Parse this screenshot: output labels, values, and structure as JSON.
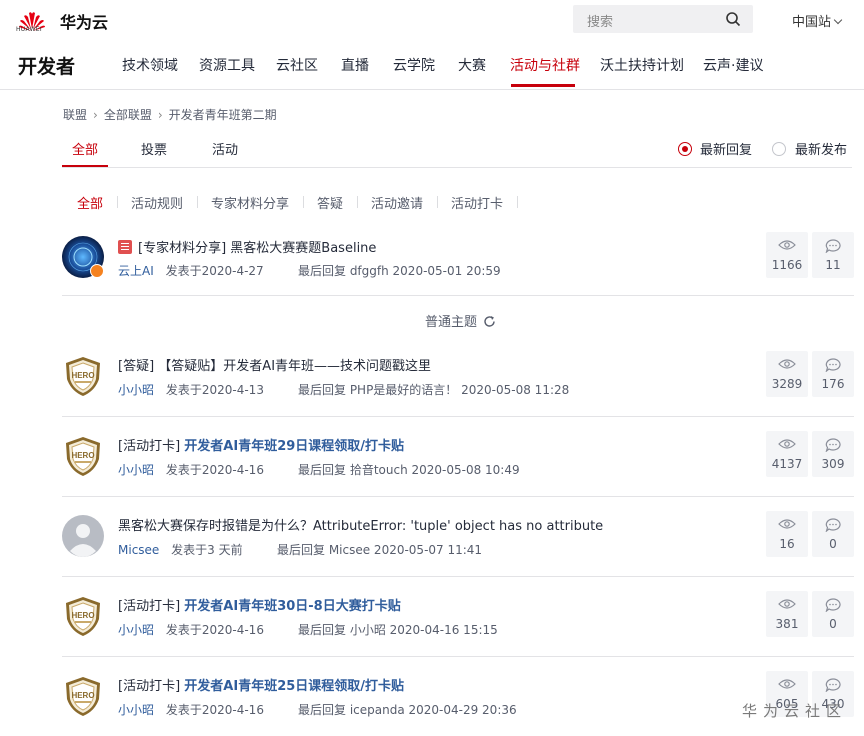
{
  "header": {
    "logo_text": "HUAWEI",
    "brand": "华为云",
    "search_placeholder": "搜索",
    "region": "中国站"
  },
  "nav": {
    "title": "开发者",
    "items": [
      "技术领域",
      "资源工具",
      "云社区",
      "直播",
      "云学院",
      "大赛",
      "活动与社群",
      "沃土扶持计划",
      "云声·建议"
    ],
    "active_index": 6
  },
  "breadcrumb": [
    "联盟",
    "全部联盟",
    "开发者青年班第二期"
  ],
  "tabs": {
    "items": [
      "全部",
      "投票",
      "活动"
    ],
    "sort_options": [
      "最新回复",
      "最新发布"
    ],
    "selected_sort": "最新回复"
  },
  "filters": [
    "全部",
    "活动规则",
    "专家材料分享",
    "答疑",
    "活动邀请",
    "活动打卡"
  ],
  "pinned_post": {
    "prefix": "[专家材料分享]",
    "title": "黑客松大赛赛题Baseline",
    "author": "云上AI",
    "posted": "发表于2020-4-27",
    "last_reply": "最后回复 dfggfh  2020-05-01 20:59",
    "views": "1166",
    "replies": "11"
  },
  "normal_topics_label": "普通主题",
  "posts": [
    {
      "prefix": "[答疑]",
      "title": "【答疑贴】开发者AI青年班——技术问题戳这里",
      "bold": false,
      "author": "小小昭",
      "posted": "发表于2020-4-13",
      "last_reply": "最后回复 PHP是最好的语言！  2020-05-08 11:28",
      "views": "3289",
      "replies": "176",
      "avatar": "hero"
    },
    {
      "prefix": "[活动打卡]",
      "title": "开发者AI青年班29日课程领取/打卡贴",
      "bold": true,
      "author": "小小昭",
      "posted": "发表于2020-4-16",
      "last_reply": "最后回复 拾音touch  2020-05-08 10:49",
      "views": "4137",
      "replies": "309",
      "avatar": "hero"
    },
    {
      "prefix": "",
      "title": "黑客松大赛保存时报错是为什么？AttributeError: 'tuple' object has no attribute",
      "bold": false,
      "author": "Micsee",
      "posted": "发表于3 天前",
      "last_reply": "最后回复 Micsee  2020-05-07 11:41",
      "views": "16",
      "replies": "0",
      "avatar": "default"
    },
    {
      "prefix": "[活动打卡]",
      "title": "开发者AI青年班30日-8日大赛打卡贴",
      "bold": true,
      "author": "小小昭",
      "posted": "发表于2020-4-16",
      "last_reply": "最后回复 小小昭  2020-04-16 15:15",
      "views": "381",
      "replies": "0",
      "avatar": "hero"
    },
    {
      "prefix": "[活动打卡]",
      "title": "开发者AI青年班25日课程领取/打卡贴",
      "bold": true,
      "author": "小小昭",
      "posted": "发表于2020-4-16",
      "last_reply": "最后回复 icepanda  2020-04-29 20:36",
      "views": "605",
      "replies": "430",
      "avatar": "hero"
    }
  ],
  "watermark": "华为云社区",
  "colors": {
    "accent": "#c7000b",
    "link": "#305d9c",
    "text": "#252b3a",
    "muted": "#575d6c"
  }
}
